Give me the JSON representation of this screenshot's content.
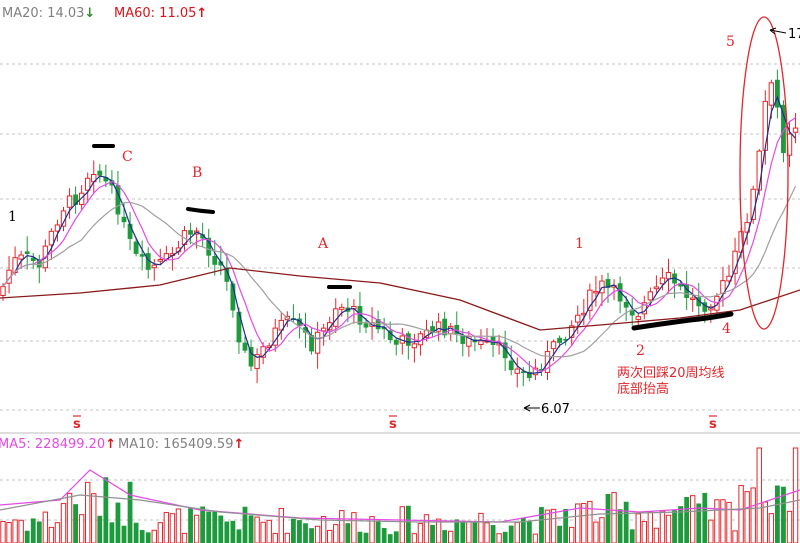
{
  "chart_data": [
    {
      "type": "candlestick",
      "panel": "price",
      "grid": true,
      "indicators": [
        {
          "name": "MA20",
          "label": "MA20:",
          "value": "14.03",
          "arrow": "↓",
          "color": "#808080",
          "arrow_color": "#2e8b2e"
        },
        {
          "name": "MA60",
          "label": "MA60:",
          "value": "11.05",
          "arrow": "↑",
          "color": "#d9131b",
          "arrow_color": "#d9131b"
        }
      ],
      "price_labels": {
        "low": "6.07",
        "high": "17"
      },
      "annotations": {
        "C": "C",
        "B": "B",
        "A": "A",
        "p1_left": "1",
        "p1_right": "1",
        "p2": "2",
        "p4": "4",
        "p5": "5",
        "note_line1": "两次回踩20周均线",
        "note_line2": "底部抬高"
      },
      "markers": [
        "s",
        "s",
        "s"
      ],
      "colors": {
        "up": "#e4262b",
        "down": "#1d9a3c",
        "ma_white": "#1f2d8f",
        "ma_short": "#e64ae6",
        "ma20": "#a0a0a0",
        "ma60": "#8b1a1a",
        "grid": "#c6c6c6"
      }
    },
    {
      "type": "bar",
      "panel": "volume",
      "indicators": [
        {
          "name": "MA5",
          "label": "MA5:",
          "value": "228499.20",
          "arrow": "↑",
          "color": "#e64ae6",
          "arrow_color": "#d9131b"
        },
        {
          "name": "MA10",
          "label": "MA10:",
          "value": "165409.59",
          "arrow": "↑",
          "color": "#808080",
          "arrow_color": "#d9131b"
        }
      ]
    }
  ]
}
